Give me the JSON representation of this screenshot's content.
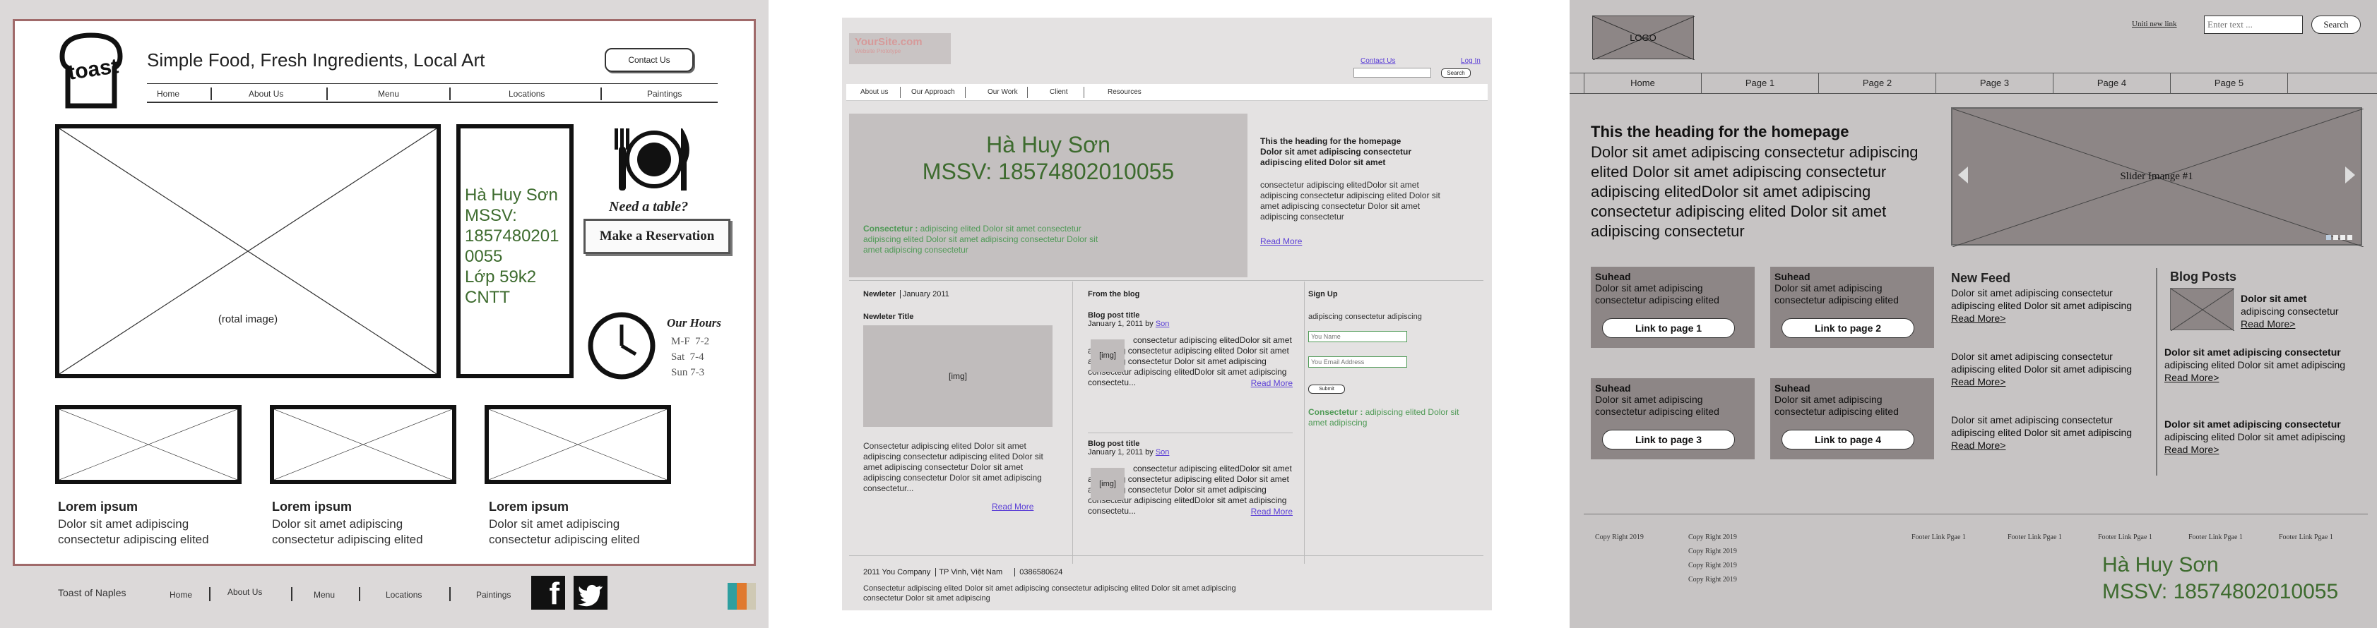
{
  "p1": {
    "logo_text": "toast",
    "tagline": "Simple Food, Fresh Ingredients, Local Art",
    "contact_button": "Contact Us",
    "nav": [
      "Home",
      "About Us",
      "Menu",
      "Locations",
      "Paintings"
    ],
    "hero_label": "(rotal image)",
    "student_info": [
      "Hà Huy Sơn",
      "MSSV:",
      "1857480201",
      "0055",
      "Lớp 59k2",
      "CNTT"
    ],
    "need_table": "Need a table?",
    "reservation_button": "Make a Reservation",
    "hours_title": "Our Hours",
    "hours": [
      "M-F  7-2",
      "Sat  7-4",
      "Sun 7-3"
    ],
    "cards": [
      {
        "title": "Lorem ipsum",
        "line1": "Dolor sit amet adipiscing",
        "line2": "consectetur adipiscing elited"
      },
      {
        "title": "Lorem ipsum",
        "line1": "Dolor sit amet adipiscing",
        "line2": "consectetur adipiscing elited"
      },
      {
        "title": "Lorem ipsum",
        "line1": "Dolor sit amet adipiscing",
        "line2": "consectetur adipiscing elited"
      }
    ],
    "footer_brand": "Toast of Naples",
    "footer_nav": [
      "Home",
      "About Us",
      "Menu",
      "Locations",
      "Paintings"
    ],
    "facebook_glyph": "f",
    "colors": {
      "frame": "#a06a6a",
      "swatch": [
        "#2f9fa0",
        "#e07a2e",
        "#cfc9b4"
      ]
    }
  },
  "p2": {
    "logo": "YourSite.com",
    "logo_sub": "Website Prototype",
    "top_links": [
      "Contact Us",
      "Log In"
    ],
    "search_button": "Search",
    "nav": [
      "About us",
      "Our Approach",
      "Our Work",
      "Client",
      "Resources"
    ],
    "hero_name": "Hà Huy Sơn",
    "hero_mssv": "MSSV: 18574802010055",
    "hero_blurb_strong": "Consectetur :",
    "hero_blurb": " adipiscing elited Dolor sit amet consectetur adipiscing elited Dolor sit amet adipiscing consectetur Dolor  sit amet adipiscing consectetur",
    "heading": "This the heading for the homepage",
    "heading_sub": "Dolor sit amet adipiscing consectetur adipiscing elited Dolor sit amet",
    "intro_text": "consectetur adipiscing elitedDolor sit amet adipiscing consectetur adipiscing elited Dolor sit amet adipiscing consectetur Dolor sit amet adipiscing consectetur",
    "read_more": "Read More",
    "newsletter_label": "Newleter",
    "newsletter_date": "January 2011",
    "newsletter_title": "Newleter Title",
    "img_label": "[img]",
    "newsletter_text": "Consectetur adipiscing elited Dolor sit amet adipiscing consectetur adipiscing elited Dolor sit amet adipiscing consectetur Dolor  sit amet adipiscing consectetur Dolor  sit amet adipiscing consectetur...",
    "read_more2": "Read More",
    "blog_heading": "From the blog",
    "posts": [
      {
        "title": "Blog post title",
        "date": "January 1, 2011 by ",
        "author": "Son",
        "text": "consectetur adipiscing elitedDolor sit amet adipiscing consectetur adipiscing elited Dolor sit amet adipiscing consectetur Dolor sit amet adipiscing consectetur adipiscing elitedDolor sit amet adipiscing consectetu...",
        "more": "Read More"
      },
      {
        "title": "Blog post title",
        "date": "January 1, 2011 by ",
        "author": "Son",
        "text": "consectetur adipiscing elitedDolor sit amet adipiscing consectetur adipiscing elited Dolor sit amet adipiscing consectetur Dolor sit amet adipiscing consectetur adipiscing elitedDolor sit amet adipiscing consectetu...",
        "more": "Read More"
      }
    ],
    "signup_heading": "Sign Up",
    "signup_text": "adipiscing consectetur adipiscing",
    "name_placeholder": "You Name",
    "email_placeholder": "You Email Address",
    "submit": "Submit",
    "signup_blurb_strong": "Consectetur :",
    "signup_blurb": " adipiscing elited Dolor sit amet adipiscing",
    "footer_company": "2011 You Company",
    "footer_city": "TP Vinh, Việt Nam",
    "footer_phone": "0386580624",
    "footer_text": "Consectetur adipiscing elited Dolor sit amet adipiscing consectetur adipiscing elited Dolor sit amet adipiscing consectetur Dolor  sit amet adipiscing"
  },
  "p3": {
    "logo": "LOGO",
    "unity_link": "Uniti new link",
    "search_placeholder": "Enter text ...",
    "search_button": "Search",
    "nav": [
      "Home",
      "Page 1",
      "Page 2",
      "Page 3",
      "Page 4",
      "Page 5"
    ],
    "heading": "This the heading for the homepage",
    "intro": "Dolor sit amet adipiscing consectetur adipiscing elited Dolor sit amet adipiscing consectetur adipiscing elitedDolor sit amet adipiscing consectetur adipiscing elited Dolor sit amet adipiscing consectetur",
    "slider_label": "Slider Imange #1",
    "tiles": [
      {
        "head": "Suhead",
        "text": "Dolor sit amet adipiscing consectetur adipiscing elited",
        "button": "Link to page 1"
      },
      {
        "head": "Suhead",
        "text": "Dolor sit amet adipiscing consectetur adipiscing elited",
        "button": "Link to page 2"
      },
      {
        "head": "Suhead",
        "text": "Dolor sit amet adipiscing consectetur adipiscing elited",
        "button": "Link to page 3"
      },
      {
        "head": "Suhead",
        "text": "Dolor sit amet adipiscing consectetur adipiscing elited",
        "button": "Link to page 4"
      }
    ],
    "news_title": "New Feed",
    "news": [
      {
        "text": "Dolor sit amet adipiscing consectetur adipiscing elited Dolor sit amet adipiscing",
        "more": "Read More>"
      },
      {
        "text": "Dolor sit amet adipiscing consectetur adipiscing elited Dolor sit amet adipiscing",
        "more": "Read More>"
      },
      {
        "text": "Dolor sit amet adipiscing consectetur adipiscing elited Dolor sit amet adipiscing",
        "more": "Read More>"
      }
    ],
    "blog_title": "Blog Posts",
    "blog_first": {
      "title": "Dolor sit amet",
      "text": "adipiscing consectetur",
      "more": "Read More>"
    },
    "blog_items": [
      {
        "title": "Dolor sit amet adipiscing consectetur",
        "text": "adipiscing elited Dolor sit amet adipiscing",
        "more": "Read More>"
      },
      {
        "title": "Dolor sit amet adipiscing consectetur",
        "text": "adipiscing elited Dolor sit amet adipiscing",
        "more": "Read More>"
      }
    ],
    "copyright": [
      "Copy Right 2019",
      "Copy Right 2019",
      "Copy Right 2019",
      "Copy Right 2019",
      "Copy Right 2019"
    ],
    "footer_links": [
      "Footer Link Pgae 1",
      "Footer Link Pgae 1",
      "Footer Link Pgae 1",
      "Footer Link Pgae 1",
      "Footer Link Pgae 1"
    ],
    "student_name": "Hà Huy Sơn",
    "student_mssv": "MSSV: 18574802010055"
  }
}
